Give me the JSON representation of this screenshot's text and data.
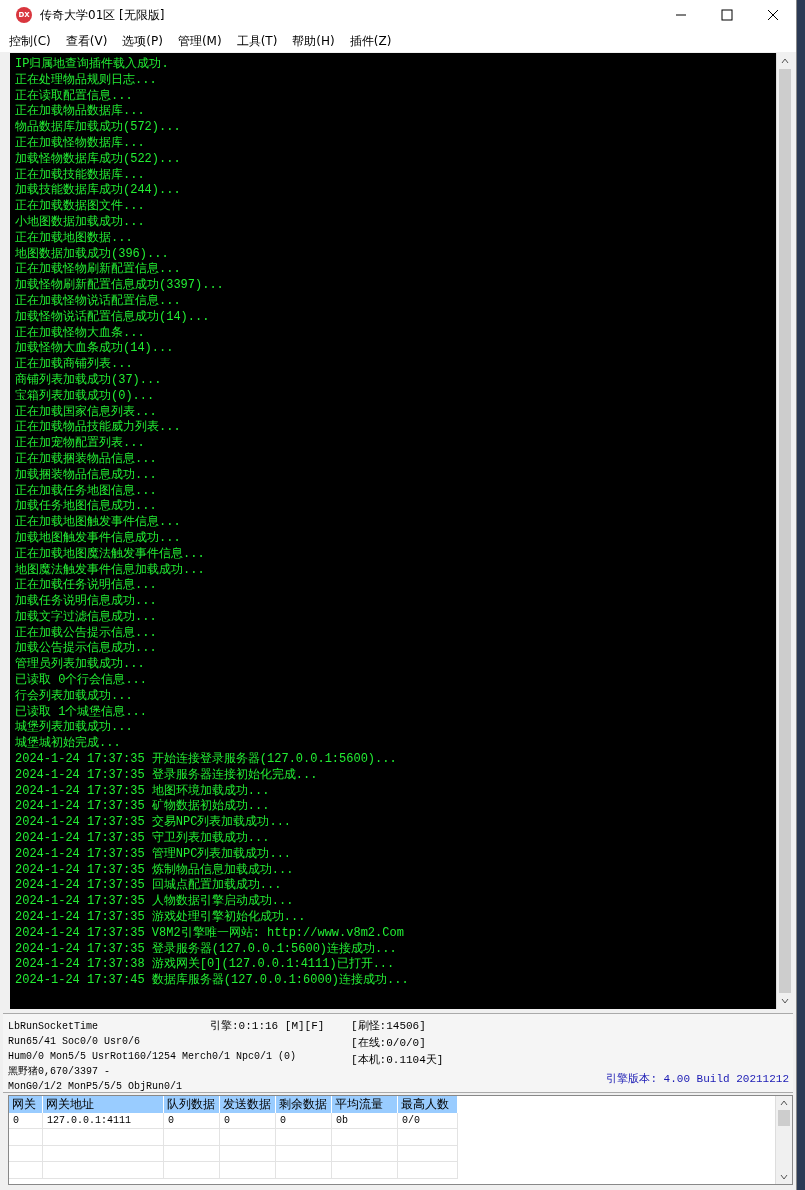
{
  "window": {
    "title": "传奇大学01区 [无限版]",
    "icon": "DX"
  },
  "menu": [
    "控制(C)",
    "查看(V)",
    "选项(P)",
    "管理(M)",
    "工具(T)",
    "帮助(H)",
    "插件(Z)"
  ],
  "log": [
    "IP归属地查询插件载入成功.",
    "正在处理物品规则日志...",
    "正在读取配置信息...",
    "正在加载物品数据库...",
    "物品数据库加载成功(572)...",
    "正在加载怪物数据库...",
    "加载怪物数据库成功(522)...",
    "正在加载技能数据库...",
    "加载技能数据库成功(244)...",
    "正在加载数据图文件...",
    "小地图数据加载成功...",
    "正在加载地图数据...",
    "地图数据加载成功(396)...",
    "正在加载怪物刷新配置信息...",
    "加载怪物刷新配置信息成功(3397)...",
    "正在加载怪物说话配置信息...",
    "加载怪物说话配置信息成功(14)...",
    "正在加载怪物大血条...",
    "加载怪物大血条成功(14)...",
    "正在加载商铺列表...",
    "商铺列表加载成功(37)...",
    "宝箱列表加载成功(0)...",
    "正在加载国家信息列表...",
    "正在加载物品技能威力列表...",
    "正在加宠物配置列表...",
    "正在加载捆装物品信息...",
    "加载捆装物品信息成功...",
    "正在加载任务地图信息...",
    "加载任务地图信息成功...",
    "正在加载地图触发事件信息...",
    "加载地图触发事件信息成功...",
    "正在加载地图魔法触发事件信息...",
    "地图魔法触发事件信息加载成功...",
    "正在加载任务说明信息...",
    "加载任务说明信息成功...",
    "加载文字过滤信息成功...",
    "正在加载公告提示信息...",
    "加载公告提示信息成功...",
    "管理员列表加载成功...",
    "已读取 0个行会信息...",
    "行会列表加载成功...",
    "已读取 1个城堡信息...",
    "城堡列表加载成功...",
    "城堡城初始完成...",
    "2024-1-24 17:37:35 开始连接登录服务器(127.0.0.1:5600)...",
    "2024-1-24 17:37:35 登录服务器连接初始化完成...",
    "2024-1-24 17:37:35 地图环境加载成功...",
    "2024-1-24 17:37:35 矿物数据初始成功...",
    "2024-1-24 17:37:35 交易NPC列表加载成功...",
    "2024-1-24 17:37:35 守卫列表加载成功...",
    "2024-1-24 17:37:35 管理NPC列表加载成功...",
    "2024-1-24 17:37:35 炼制物品信息加载成功...",
    "2024-1-24 17:37:35 回城点配置加载成功...",
    "2024-1-24 17:37:35 人物数据引擎启动成功...",
    "2024-1-24 17:37:35 游戏处理引擎初始化成功...",
    "2024-1-24 17:37:35 V8M2引擎唯一网站: http://www.v8m2.Com",
    "2024-1-24 17:37:35 登录服务器(127.0.0.1:5600)连接成功...",
    "2024-1-24 17:37:38 游戏网关[0](127.0.0.1:4111)已打开...",
    "2024-1-24 17:37:45 数据库服务器(127.0.0.1:6000)连接成功..."
  ],
  "status": {
    "left": [
      "LbRunSocketTime",
      "Run65/41 Soc0/0 Usr0/6",
      "Hum0/0 Mon5/5 UsrRot160/1254 Merch0/1 Npc0/1 (0)",
      "黑野猪0,670/3397 -",
      "MonG0/1/2 MonP5/5/5 ObjRun0/1"
    ],
    "engine": "引擎:0:1:16 [M][F]",
    "right": [
      "[刷怪:14506]",
      "[在线:0/0/0]",
      "[本机:0.1104天]"
    ],
    "version": "引擎版本: 4.00 Build 20211212"
  },
  "table": {
    "columns": [
      "网关",
      "网关地址",
      "队列数据",
      "发送数据",
      "剩余数据",
      "平均流量",
      "最高人数"
    ],
    "rows": [
      [
        "0",
        "127.0.0.1:4111",
        "0",
        "0",
        "0",
        "0b",
        "0/0"
      ]
    ]
  }
}
